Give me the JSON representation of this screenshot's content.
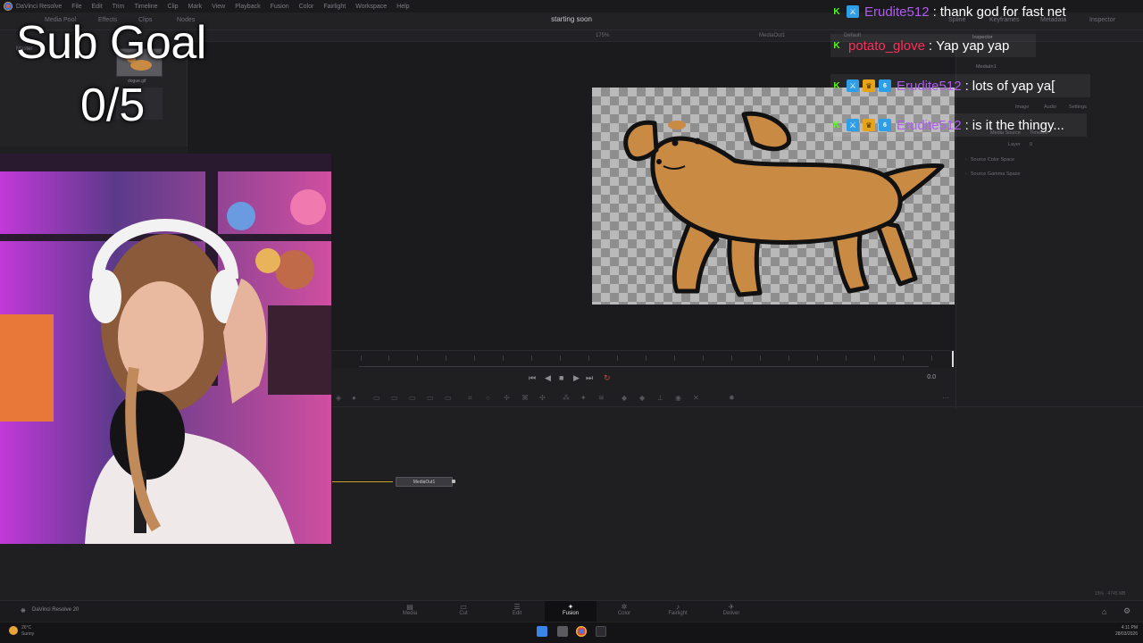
{
  "menubar": {
    "items": [
      "DaVinci Resolve",
      "File",
      "Edit",
      "Trim",
      "Timeline",
      "Clip",
      "Mark",
      "View",
      "Playback",
      "Fusion",
      "Color",
      "Fairlight",
      "Workspace",
      "Help"
    ]
  },
  "toolbar": {
    "media_pool": "Media Pool",
    "effects": "Effects",
    "clips": "Clips",
    "nodes": "Nodes",
    "project_title": "starting soon",
    "spline": "Spline",
    "keyframes": "Keyframes",
    "metadata": "Metadata",
    "inspector": "Inspector"
  },
  "subbar": {
    "zoom": "175%",
    "viewer_label": "MediaOut1",
    "default_label": "Default"
  },
  "media_pool": {
    "master_label": "Master",
    "clip_name": "dogue.gif"
  },
  "inspector": {
    "title": "Inspector",
    "node_name": "MediaIn1",
    "tabs": [
      "Image",
      "Audio",
      "Settings"
    ],
    "media_source_label": "Media Source",
    "media_source_value": "Timeline",
    "layer_label": "Layer",
    "layer_value": "0",
    "sections": [
      "Source Color Space",
      "Source Gamma Space"
    ]
  },
  "transport": {
    "timecode": "0.0"
  },
  "nodes": {
    "mediaout_label": "MediaOut1"
  },
  "pages": {
    "items": [
      {
        "label": "Media",
        "icon": "media-page-icon"
      },
      {
        "label": "Cut",
        "icon": "cut-page-icon"
      },
      {
        "label": "Edit",
        "icon": "edit-page-icon"
      },
      {
        "label": "Fusion",
        "icon": "fusion-page-icon"
      },
      {
        "label": "Color",
        "icon": "color-page-icon"
      },
      {
        "label": "Fairlight",
        "icon": "fairlight-page-icon"
      },
      {
        "label": "Deliver",
        "icon": "deliver-page-icon"
      }
    ],
    "active": "Fusion"
  },
  "app_name": "DaVinci Resolve 20",
  "status": {
    "memory": "15% · 4745 MB"
  },
  "taskbar": {
    "weather_temp": "26°C",
    "weather_desc": "Sunny",
    "time": "4:11 PM",
    "date": "28/03/2026"
  },
  "overlay": {
    "goal_title": "Sub Goal",
    "goal_count": "0/5"
  },
  "chat": [
    {
      "user": "Erudite512",
      "message": "thank god for fast net",
      "user_color": "#b05cf0",
      "badges": [
        "k",
        "mod"
      ]
    },
    {
      "user": "potato_glove",
      "message": "Yap yap yap",
      "user_color": "#ff2f5b",
      "badges": [
        "k"
      ]
    },
    {
      "user": "Erudite512",
      "message": "lots of yap ya[",
      "user_color": "#b05cf0",
      "badges": [
        "k",
        "mod",
        "vip",
        "sub"
      ]
    },
    {
      "user": "Erudite512",
      "message": "is it the thingy...",
      "user_color": "#b05cf0",
      "badges": [
        "k",
        "mod",
        "vip",
        "sub"
      ]
    }
  ],
  "colors": {
    "accent_yellow": "#c9a227",
    "kick_green": "#53fc18",
    "active_page_bg": "#101012"
  }
}
